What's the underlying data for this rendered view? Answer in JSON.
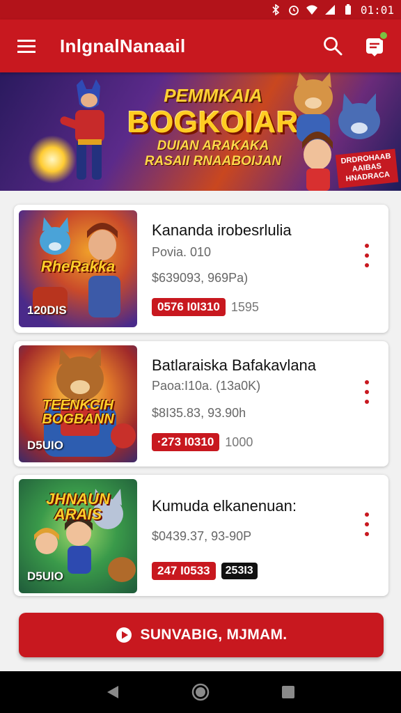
{
  "status_bar": {
    "time": "01:01",
    "icons": [
      "bluetooth-icon",
      "alarm-icon",
      "wifi-icon",
      "signal-icon",
      "battery-icon"
    ]
  },
  "app_bar": {
    "title": "InlgnalNanaail",
    "menu_icon": "hamburger-menu-icon",
    "search_icon": "search-icon",
    "notifications_icon": "notification-bell-icon"
  },
  "banner": {
    "headline_top": "PEMMKAIA",
    "headline_main": "BOGKOIAR",
    "headline_sub_1": "DUIAN ARAKAKA",
    "headline_sub_2": "RASAII RNAABOIJAN",
    "corner_tag": "DRDROHAAB AAIBAS HNADRACA"
  },
  "items": [
    {
      "title": "Kananda irobesrlulia",
      "subtitle": "Povia. 010",
      "price": "$639093, 969Pa)",
      "thumb_title": "RheRakka",
      "thumb_corner": "120DIS",
      "tag_red": "0576 I0I310",
      "tag_extra": "1595",
      "tag_extra_style": "plain"
    },
    {
      "title": "Batlaraiska Bafakavlana",
      "subtitle": "Paoa:I10a. (13a0K)",
      "price": "$8I35.83, 93.90h",
      "thumb_title": "TEENKCIH BOGBANN",
      "thumb_corner": "D5UIO",
      "tag_red": "·273 I0310",
      "tag_extra": "1000",
      "tag_extra_style": "plain"
    },
    {
      "title": "Kumuda elkanenuan:",
      "subtitle": "",
      "price": "$0439.37, 93-90P",
      "thumb_title": "JHNAUN ARAIS",
      "thumb_corner": "D5UIO",
      "tag_red": "247 I0533",
      "tag_extra": "253I3",
      "tag_extra_style": "dark"
    }
  ],
  "cta": {
    "label": "SUNVABIG, MJMAM.",
    "icon": "play-circle-icon"
  },
  "colors": {
    "primary_red": "#c8181f",
    "status_red": "#b3131a",
    "background": "#f1f1f1",
    "card": "#ffffff"
  },
  "nav_bar": {
    "back_icon": "nav-back-icon",
    "home_icon": "nav-home-icon",
    "recents_icon": "nav-recents-icon"
  }
}
